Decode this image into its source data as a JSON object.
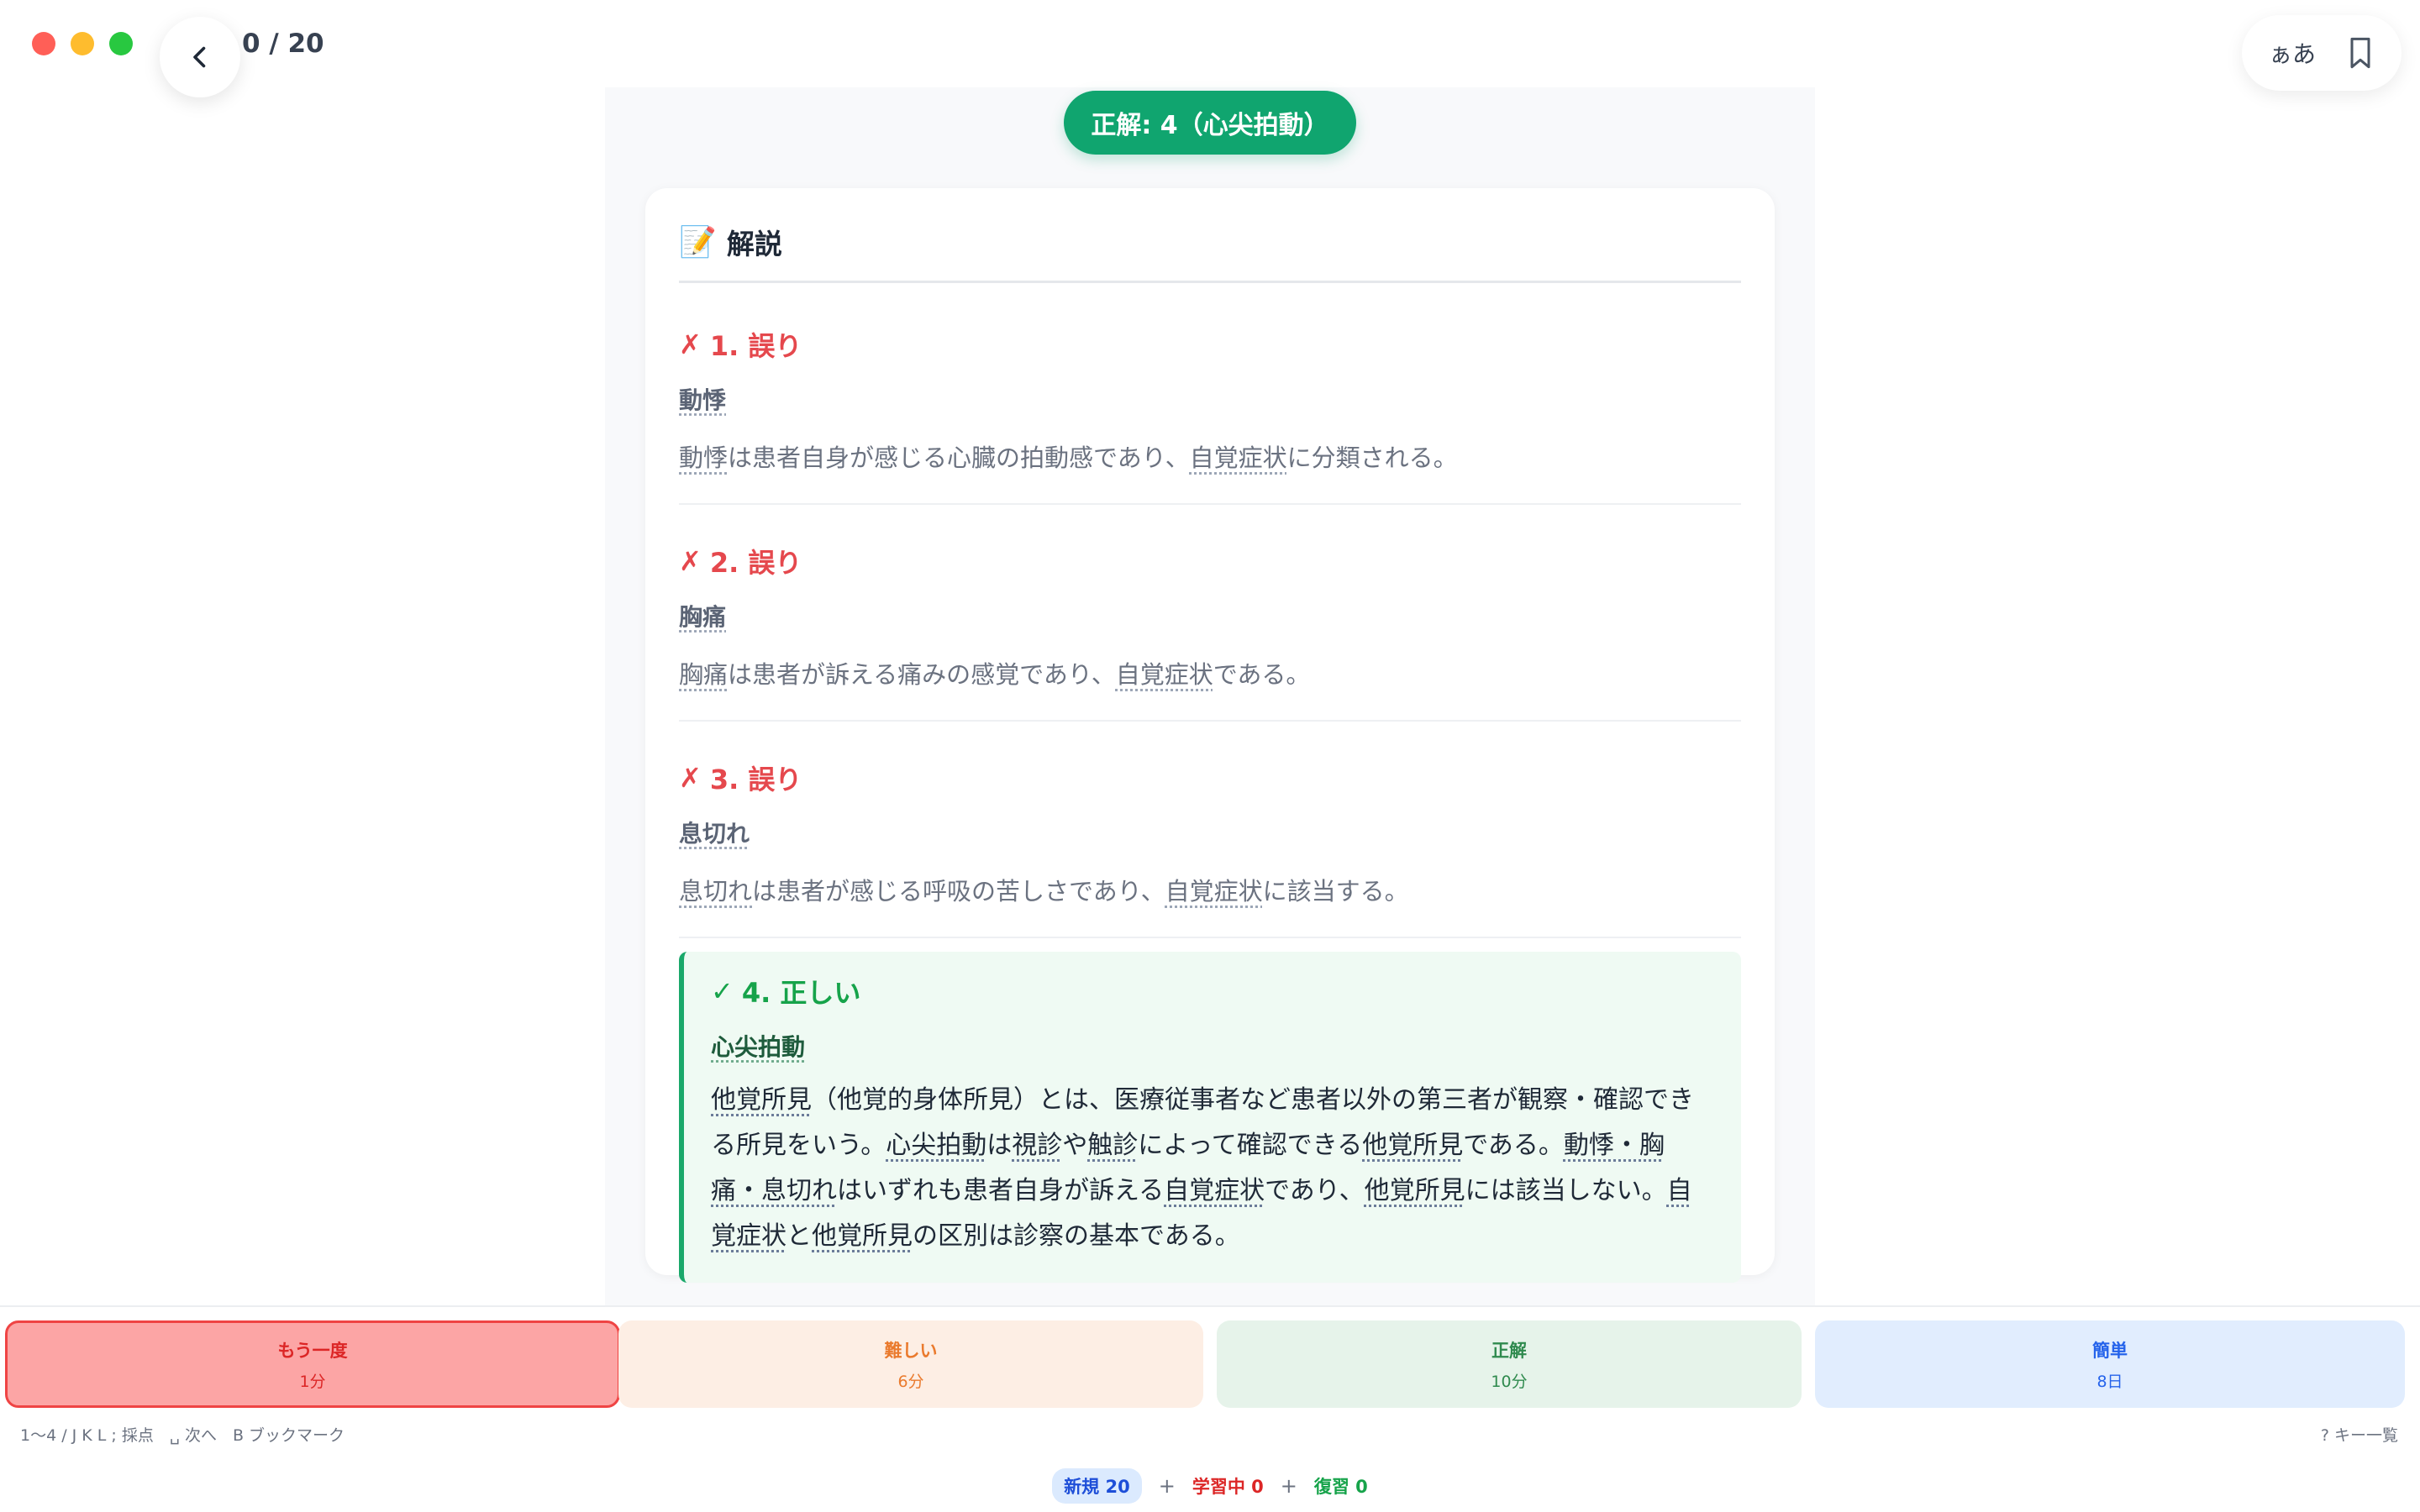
{
  "topbar": {
    "progress": "0 / 20",
    "font_toggle": "ぁあ"
  },
  "answer": {
    "label": "正解: 4（心尖拍動）"
  },
  "explanation": {
    "title": "解説",
    "icon": "memo-icon",
    "wrong_mark": "✗",
    "correct_mark": "✓",
    "options": [
      {
        "header": "1. 誤り",
        "term": "動悸",
        "desc": [
          {
            "t": "動悸",
            "u": true
          },
          {
            "t": "は患者自身が感じる心臓の拍動感であり、",
            "u": false
          },
          {
            "t": "自覚症状",
            "u": true
          },
          {
            "t": "に分類される。",
            "u": false
          }
        ]
      },
      {
        "header": "2. 誤り",
        "term": "胸痛",
        "desc": [
          {
            "t": "胸痛",
            "u": true
          },
          {
            "t": "は患者が訴える痛みの感覚であり、",
            "u": false
          },
          {
            "t": "自覚症状",
            "u": true
          },
          {
            "t": "である。",
            "u": false
          }
        ]
      },
      {
        "header": "3. 誤り",
        "term": "息切れ",
        "desc": [
          {
            "t": "息切れ",
            "u": true
          },
          {
            "t": "は患者が感じる呼吸の苦しさであり、",
            "u": false
          },
          {
            "t": "自覚症状",
            "u": true
          },
          {
            "t": "に該当する。",
            "u": false
          }
        ]
      }
    ],
    "correct": {
      "header": "4. 正しい",
      "term": "心尖拍動",
      "desc": [
        {
          "t": "他覚所見",
          "u": true
        },
        {
          "t": "（他覚的身体所見）とは、医療従事者など患者以外の第三者が観察・確認できる所見をいう。",
          "u": false
        },
        {
          "t": "心尖拍動",
          "u": true
        },
        {
          "t": "は",
          "u": false
        },
        {
          "t": "視診",
          "u": true
        },
        {
          "t": "や",
          "u": false
        },
        {
          "t": "触診",
          "u": true
        },
        {
          "t": "によって確認できる",
          "u": false
        },
        {
          "t": "他覚所見",
          "u": true
        },
        {
          "t": "である。",
          "u": false
        },
        {
          "t": "動悸・胸痛・息切れ",
          "u": true
        },
        {
          "t": "はいずれも患者自身が訴える",
          "u": false
        },
        {
          "t": "自覚症状",
          "u": true
        },
        {
          "t": "であり、",
          "u": false
        },
        {
          "t": "他覚所見",
          "u": true
        },
        {
          "t": "には該当しない。",
          "u": false
        },
        {
          "t": "自覚症状",
          "u": true
        },
        {
          "t": "と",
          "u": false
        },
        {
          "t": "他覚所見",
          "u": true
        },
        {
          "t": "の区別は診察の基本である。",
          "u": false
        }
      ]
    }
  },
  "rating": {
    "again": {
      "label": "もう一度",
      "interval": "1分"
    },
    "hard": {
      "label": "難しい",
      "interval": "6分"
    },
    "good": {
      "label": "正解",
      "interval": "10分"
    },
    "easy": {
      "label": "簡単",
      "interval": "8日"
    }
  },
  "hints": {
    "shortcuts": "1〜4 / J K L ; 採点　␣ 次へ　B ブックマーク",
    "key_list": "? キー一覧"
  },
  "counts": {
    "new": "新規 20",
    "plus": "+",
    "learning": "学習中 0",
    "review": "復習 0"
  },
  "colors": {
    "accent_green": "#10a56f",
    "wrong_red": "#e5484d",
    "again_bg": "#fca5a5",
    "hard_bg": "#fdeee4",
    "good_bg": "#e6f3ea",
    "easy_bg": "#e1edfe"
  }
}
